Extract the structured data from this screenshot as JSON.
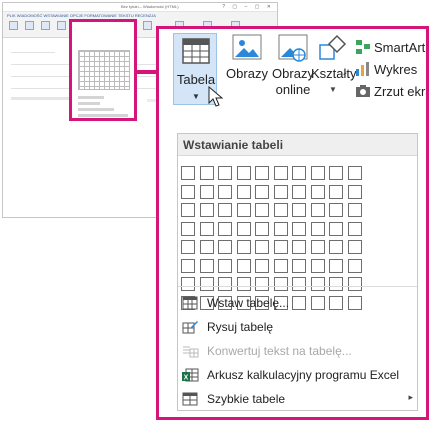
{
  "thumbnail": {
    "window_title": "Bez tytułu – Wiadomość (HTML)",
    "window_controls": "? ▢ – ▢ ✕",
    "ribbon_tabs": "PLIK   WIADOMOŚĆ   WSTAWIANIE   OPCJE   FORMATOWANIE TEKSTU   RECENZJA"
  },
  "ribbon": {
    "tabela_label": "Tabela",
    "obrazy_label": "Obrazy",
    "obrazy_online_line1": "Obrazy",
    "obrazy_online_line2": "online",
    "ksztalty_label": "Kształty",
    "smartart_label": "SmartArt",
    "wykres_label": "Wykres",
    "zrzut_label": "Zrzut ekra"
  },
  "dropdown": {
    "header": "Wstawianie tabeli",
    "grid": {
      "columns": 10,
      "rows": 8
    },
    "items": [
      {
        "label": "Wstaw tabelę...",
        "disabled": false
      },
      {
        "label": "Rysuj tabelę",
        "disabled": false
      },
      {
        "label": "Konwertuj tekst na tabelę...",
        "disabled": true
      },
      {
        "label": "Arkusz kalkulacyjny programu Excel",
        "disabled": false
      },
      {
        "label": "Szybkie tabele",
        "disabled": false,
        "submenu": "▸"
      }
    ]
  },
  "colors": {
    "highlight": "#d6157a",
    "selected_button": "#d3e5f7",
    "accent_blue": "#2b579a"
  }
}
